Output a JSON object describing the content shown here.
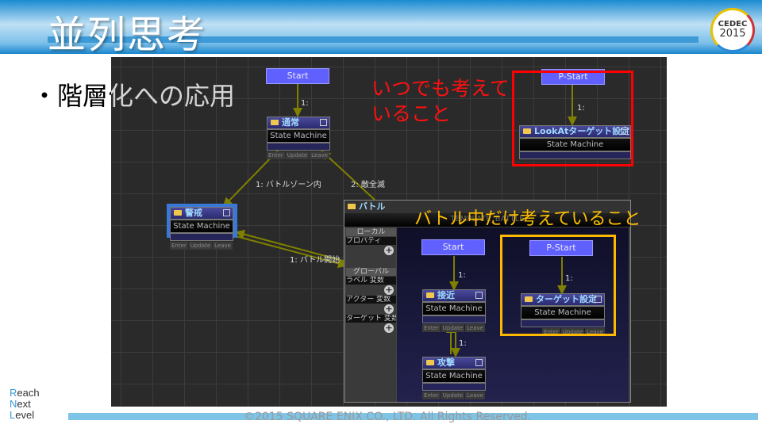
{
  "slide": {
    "title": "並列思考",
    "bullet": "・階層化への応用",
    "red_note_line1": "いつでも考えて",
    "red_note_line2": "いること",
    "orange_note": "バトル中だけ考えていること",
    "copyright": "©2015 SQUARE ENIX CO., LTD. All Rights Reserved.",
    "cedec_logo": "CEDEC",
    "cedec_year": "2015",
    "logo_lines": [
      "Reach",
      "Next",
      "Level"
    ]
  },
  "graph": {
    "start": "Start",
    "pstart": "P-Start",
    "sm": "State Machine",
    "enter": "Enter",
    "update": "Update",
    "leave": "Leave",
    "nodes": {
      "normal": "通常",
      "alert": "警戒",
      "battle": "バトル",
      "approach": "接近",
      "attack": "攻撃",
      "target": "ターゲット設定",
      "lookat": "LookAtターゲット設定"
    },
    "battle_template": "TEMPLATE_BATTLE",
    "transitions": {
      "t1": "1:",
      "zone": "1: バトルゾーン内",
      "clear": "2: 敵全滅",
      "begin": "1: バトル開始"
    },
    "sidebar": {
      "local": "ローカル",
      "property": "プロパティ",
      "global": "グローバル",
      "label_var": "ラベル 変数",
      "actor_var": "アクター 変数",
      "target_var": "ターゲット 変数",
      "add": "+"
    },
    "colors": {
      "arrow": "#808000",
      "red_box": "#ff0000",
      "orange_box": "#ffb800"
    }
  }
}
